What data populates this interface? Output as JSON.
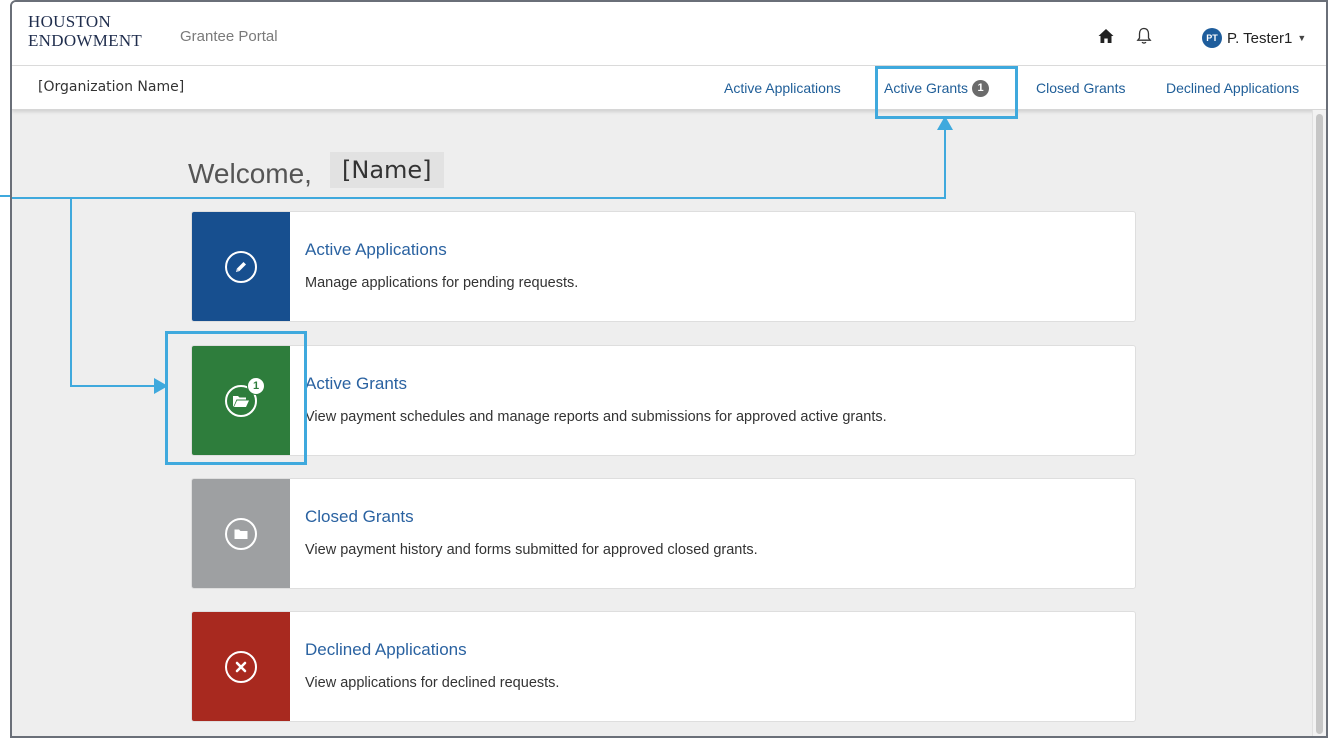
{
  "header": {
    "logo_line1": "HOUSTON",
    "logo_line2": "ENDOWMENT",
    "portal_title": "Grantee Portal",
    "user_initials": "PT",
    "user_name": "P. Tester1",
    "icons": [
      "home-icon",
      "bell-icon",
      "caret-down-icon"
    ]
  },
  "subnav": {
    "org_name": "[Organization Name]",
    "links": [
      {
        "label": "Active Applications"
      },
      {
        "label": "Active Grants",
        "badge": "1"
      },
      {
        "label": "Closed Grants"
      },
      {
        "label": "Declined Applications"
      }
    ]
  },
  "main": {
    "welcome": "Welcome,",
    "user_placeholder": "[Name]",
    "cards": [
      {
        "title": "Active Applications",
        "description": "Manage applications for pending requests.",
        "color": "#174f8f",
        "icon": "pencil-icon"
      },
      {
        "title": "Active Grants",
        "description": "View payment schedules and manage reports and submissions for approved active grants.",
        "color": "#2e7d3c",
        "icon": "folder-open-icon",
        "badge": "1"
      },
      {
        "title": "Closed Grants",
        "description": "View payment history and forms submitted for approved closed grants.",
        "color": "#9ea0a2",
        "icon": "folder-icon"
      },
      {
        "title": "Declined Applications",
        "description": "View applications for declined requests.",
        "color": "#a8291f",
        "icon": "close-x-icon"
      }
    ]
  },
  "colors": {
    "annotation": "#3fa9dd",
    "link": "#1f5e98"
  }
}
